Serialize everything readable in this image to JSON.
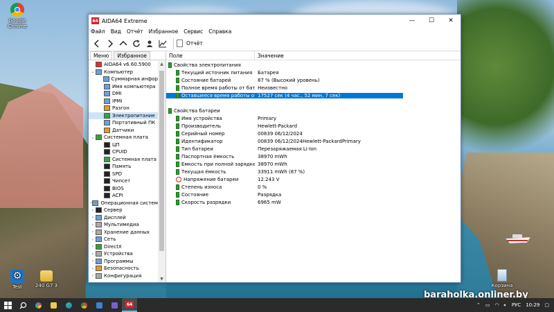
{
  "desktop": {
    "icons": [
      {
        "label": "Google Chrome",
        "icon": "chrome-icon"
      },
      {
        "label": "Test",
        "icon": "gear-icon"
      },
      {
        "label": "240 G7 3",
        "icon": "folder-icon"
      },
      {
        "label": "Корзина",
        "icon": "recycle-bin-icon"
      }
    ],
    "watermark": "baraholka.onliner.by"
  },
  "window": {
    "logo": "64",
    "title": "AIDA64 Extreme",
    "controls": {
      "minimize": "—",
      "maximize": "☐",
      "close": "✕"
    },
    "menu": [
      "Файл",
      "Вид",
      "Отчёт",
      "Избранное",
      "Сервис",
      "Справка"
    ],
    "toolbar": {
      "report_label": "Отчёт"
    },
    "tabs": {
      "menu": "Меню",
      "favorites": "Избранное"
    },
    "tree": [
      {
        "label": "AIDA64 v6.60.5900",
        "level": 0,
        "expander": "",
        "icon": "red"
      },
      {
        "label": "Компьютер",
        "level": 0,
        "expander": "⌄",
        "icon": "blue"
      },
      {
        "label": "Суммарная инфор",
        "level": 1,
        "expander": "",
        "icon": "blue"
      },
      {
        "label": "Имя компьютера",
        "level": 1,
        "expander": "",
        "icon": "blue"
      },
      {
        "label": "DMI",
        "level": 1,
        "expander": "",
        "icon": "blue"
      },
      {
        "label": "IPMI",
        "level": 1,
        "expander": "",
        "icon": "blue"
      },
      {
        "label": "Разгон",
        "level": 1,
        "expander": "",
        "icon": "orange"
      },
      {
        "label": "Электропитание",
        "level": 1,
        "expander": "",
        "icon": "green",
        "selected": true
      },
      {
        "label": "Портативный ПК",
        "level": 1,
        "expander": "",
        "icon": "blue"
      },
      {
        "label": "Датчики",
        "level": 1,
        "expander": "",
        "icon": "orange"
      },
      {
        "label": "Системная плата",
        "level": 0,
        "expander": "⌄",
        "icon": "green"
      },
      {
        "label": "ЦП",
        "level": 1,
        "expander": "",
        "icon": "chip"
      },
      {
        "label": "CPUID",
        "level": 1,
        "expander": "",
        "icon": "chip"
      },
      {
        "label": "Системная плата",
        "level": 1,
        "expander": "",
        "icon": "green"
      },
      {
        "label": "Память",
        "level": 1,
        "expander": "",
        "icon": "chip"
      },
      {
        "label": "SPD",
        "level": 1,
        "expander": "",
        "icon": "chip"
      },
      {
        "label": "Чипсет",
        "level": 1,
        "expander": "",
        "icon": "chip"
      },
      {
        "label": "BIOS",
        "level": 1,
        "expander": "",
        "icon": "chip"
      },
      {
        "label": "ACPI",
        "level": 1,
        "expander": "",
        "icon": "chip"
      },
      {
        "label": "Операционная систем",
        "level": 0,
        "expander": "›",
        "icon": "blue"
      },
      {
        "label": "Сервер",
        "level": 0,
        "expander": "›",
        "icon": "chip"
      },
      {
        "label": "Дисплей",
        "level": 0,
        "expander": "›",
        "icon": "blue"
      },
      {
        "label": "Мультимедиа",
        "level": 0,
        "expander": "›",
        "icon": "gray"
      },
      {
        "label": "Хранение данных",
        "level": 0,
        "expander": "›",
        "icon": "gray"
      },
      {
        "label": "Сеть",
        "level": 0,
        "expander": "›",
        "icon": "blue"
      },
      {
        "label": "DirectX",
        "level": 0,
        "expander": "›",
        "icon": "green"
      },
      {
        "label": "Устройства",
        "level": 0,
        "expander": "›",
        "icon": "gray"
      },
      {
        "label": "Программы",
        "level": 0,
        "expander": "›",
        "icon": "blue"
      },
      {
        "label": "Безопасность",
        "level": 0,
        "expander": "›",
        "icon": "orange"
      },
      {
        "label": "Конфигурация",
        "level": 0,
        "expander": "›",
        "icon": "gray"
      }
    ],
    "columns": {
      "field": "Поле",
      "value": "Значение"
    },
    "sections": [
      {
        "title": "Свойства электропитания",
        "rows": [
          {
            "field": "Текущий источник питания",
            "value": "Батарея"
          },
          {
            "field": "Состояние батарей",
            "value": "87 % (Высокий уровень)"
          },
          {
            "field": "Полное время работы от бата...",
            "value": "Неизвестно"
          },
          {
            "field": "Оставшееся время работы от ...",
            "value": "17527 сек (4 час., 52 мин, 7 сек)",
            "selected": true
          }
        ]
      },
      {
        "title": "Свойства батареи",
        "rows": [
          {
            "field": "Имя устройства",
            "value": "Primary"
          },
          {
            "field": "Производитель",
            "value": "Hewlett-Packard"
          },
          {
            "field": "Серийный номер",
            "value": "00839 06/12/2024"
          },
          {
            "field": "Идентификатор",
            "value": "00839 06/12/2024Hewlett-PackardPrimary"
          },
          {
            "field": "Тип батареи",
            "value": "Перезаряжаемая Li-Ion"
          },
          {
            "field": "Паспортная ёмкость",
            "value": "38970 mWh"
          },
          {
            "field": "Ёмкость при полной зарядке",
            "value": "38970 mWh"
          },
          {
            "field": "Текущая ёмкость",
            "value": "33911 mWh  (87 %)"
          },
          {
            "field": "Напряжение батареи",
            "value": "12.243 V",
            "warn": true
          },
          {
            "field": "Степень износа",
            "value": "0 %"
          },
          {
            "field": "Состояние",
            "value": "Разрядка"
          },
          {
            "field": "Скорость разрядки",
            "value": "6965 mW"
          }
        ]
      }
    ]
  },
  "taskbar": {
    "items": [
      "windows-icon",
      "search-icon",
      "multicolor-icon",
      "folder-icon",
      "edge-icon",
      "chrome-icon",
      "store-icon",
      "save-icon",
      "aida64-icon"
    ],
    "aida_label": "64",
    "lang": "РУС",
    "time": "10:29"
  }
}
